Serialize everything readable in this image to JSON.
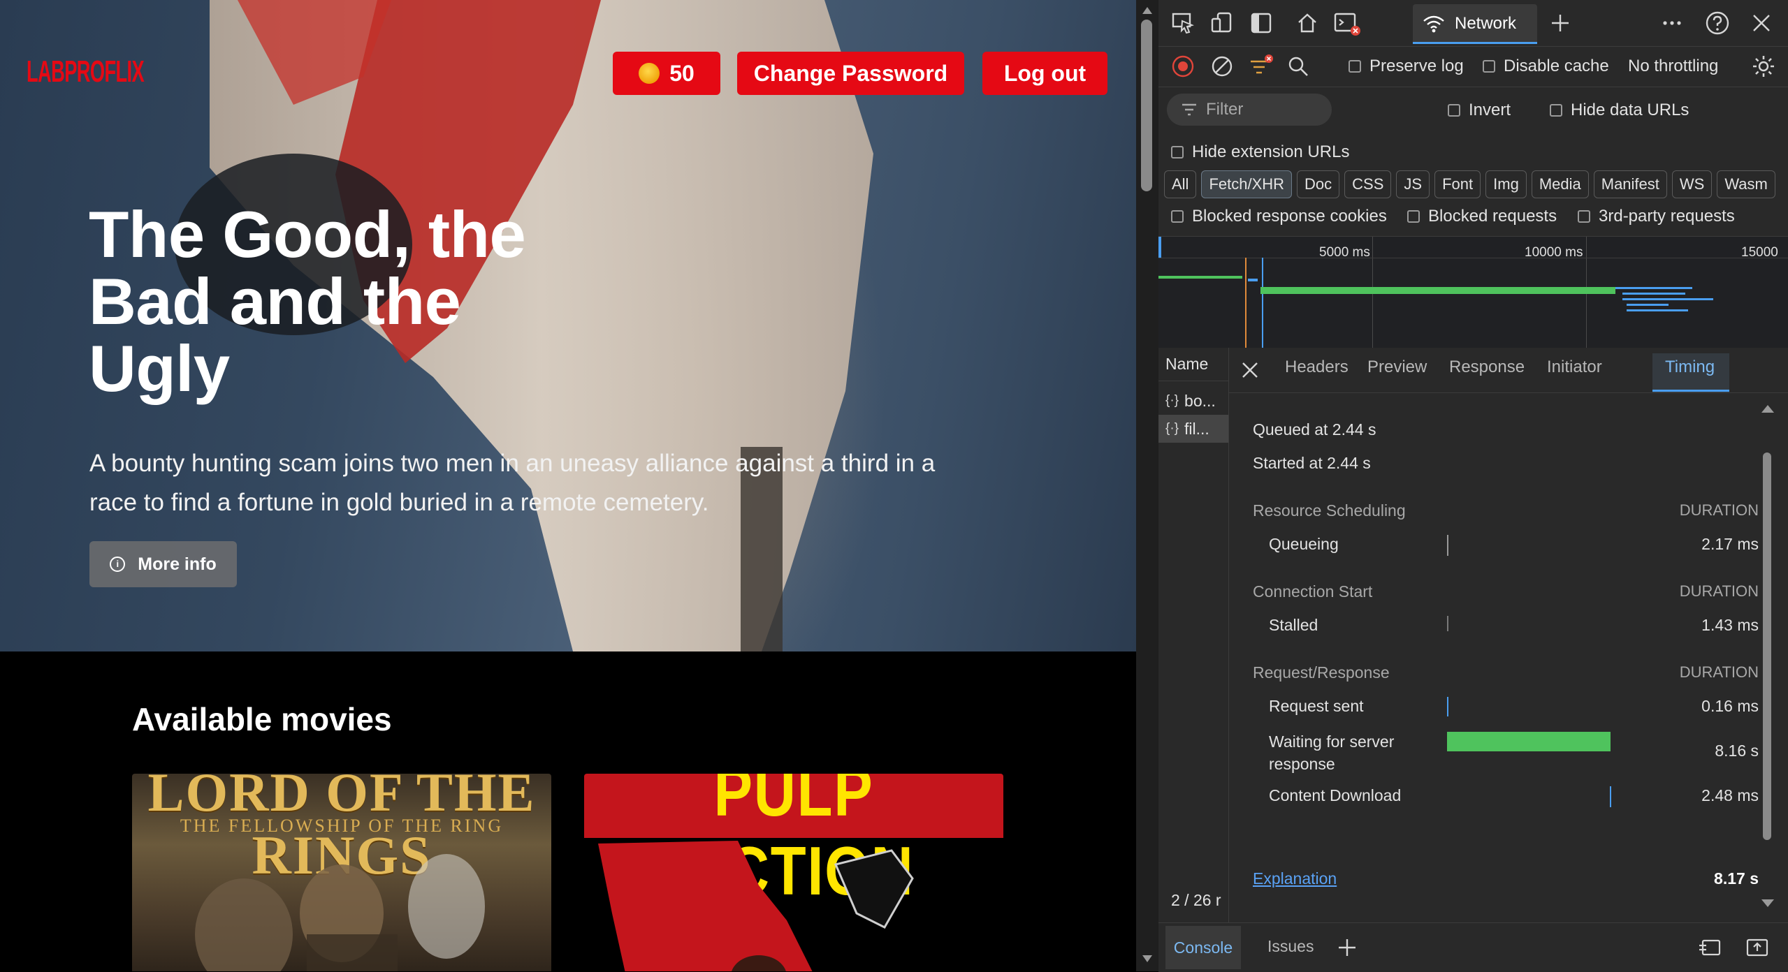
{
  "site": {
    "logo": "LABPROFLIX",
    "coins": "50",
    "change_password": "Change Password",
    "logout": "Log out",
    "hero": {
      "title": "The Good, the Bad and the Ugly",
      "description": "A bounty hunting scam joins two men in an uneasy alliance against a third in a race to find a fortune in gold buried in a remote cemetery.",
      "more_info": "More info",
      "info_icon": "i"
    },
    "movies_heading": "Available movies",
    "posters": [
      {
        "title": "LORD OF THE RINGS",
        "subtitle": "THE FELLOWSHIP OF THE RING"
      },
      {
        "title": "PULP FICTION"
      }
    ]
  },
  "devtools": {
    "tabs": {
      "network": "Network"
    },
    "toolbar": {
      "preserve_log": "Preserve log",
      "disable_cache": "Disable cache",
      "throttling": "No throttling"
    },
    "filter": {
      "placeholder": "Filter",
      "invert": "Invert",
      "hide_data_urls": "Hide data URLs",
      "hide_extension_urls": "Hide extension URLs"
    },
    "type_filters": [
      "All",
      "Fetch/XHR",
      "Doc",
      "CSS",
      "JS",
      "Font",
      "Img",
      "Media",
      "Manifest",
      "WS",
      "Wasm"
    ],
    "active_type_filter": "Fetch/XHR",
    "blocked": {
      "cookies": "Blocked response cookies",
      "requests": "Blocked requests",
      "third_party": "3rd-party requests"
    },
    "overview_ticks": [
      "5000 ms",
      "10000 ms",
      "15000"
    ],
    "requests": {
      "header": "Name",
      "rows": [
        "bo...",
        "fil..."
      ],
      "count": "2 / 26 r"
    },
    "detail_tabs": [
      "Headers",
      "Preview",
      "Response",
      "Initiator",
      "Timing"
    ],
    "active_detail_tab": "Timing",
    "timing": {
      "queued": "Queued at 2.44 s",
      "started": "Started at 2.44 s",
      "duration_label": "DURATION",
      "sections": [
        {
          "title": "Resource Scheduling",
          "rows": [
            {
              "label": "Queueing",
              "value": "2.17 ms"
            }
          ]
        },
        {
          "title": "Connection Start",
          "rows": [
            {
              "label": "Stalled",
              "value": "1.43 ms"
            }
          ]
        },
        {
          "title": "Request/Response",
          "rows": [
            {
              "label": "Request sent",
              "value": "0.16 ms"
            },
            {
              "label": "Waiting for server response",
              "value": "8.16 s"
            },
            {
              "label": "Content Download",
              "value": "2.48 ms"
            }
          ]
        }
      ],
      "explanation": "Explanation",
      "total": "8.17 s"
    },
    "drawer": {
      "console": "Console",
      "issues": "Issues"
    },
    "colors": {
      "accent": "#4a9ef0",
      "waiting_bar": "#4fc35d",
      "record": "#e0453a",
      "brand_red": "#e50914"
    }
  }
}
